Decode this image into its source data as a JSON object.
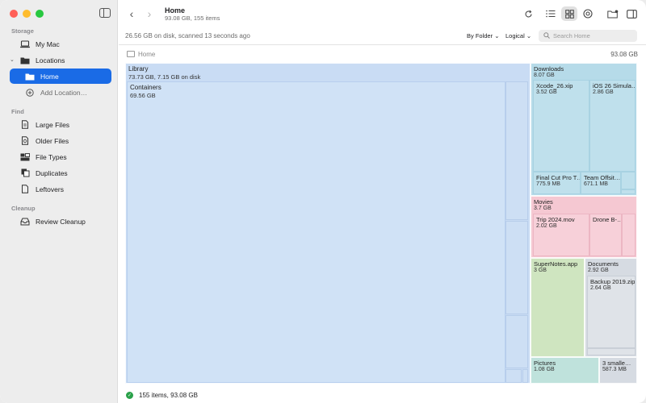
{
  "window": {
    "traffic_colors": [
      "#ff5f57",
      "#febc2e",
      "#28c840"
    ]
  },
  "sidebar": {
    "sections": [
      {
        "title": "Storage"
      },
      {
        "title": "Find"
      },
      {
        "title": "Cleanup"
      }
    ],
    "storage_item": "My Mac",
    "locations_label": "Locations",
    "locations_children": [
      "Home",
      "Add Location…"
    ],
    "find_items": [
      "Large Files",
      "Older Files",
      "File Types",
      "Duplicates",
      "Leftovers"
    ],
    "cleanup_items": [
      "Review Cleanup"
    ],
    "selected_color": "#1a6be6"
  },
  "toolbar": {
    "title": "Home",
    "subtitle": "93.08 GB, 155 items",
    "icons": [
      "chevron-left-icon",
      "chevron-right-icon",
      "refresh-icon",
      "list-view-icon",
      "grid-view-icon",
      "target-icon",
      "folder-badge-icon",
      "sidebar-right-icon"
    ]
  },
  "infobar": {
    "scanned": "26.56 GB on disk, scanned 13 seconds ago",
    "group_by": "By Folder",
    "size_mode": "Logical",
    "search_placeholder": "Search Home"
  },
  "pathbar": {
    "path": "Home",
    "size": "93.08 GB"
  },
  "treemap": {
    "library": {
      "name": "Library",
      "size": "73.73 GB, 7.15 GB on disk"
    },
    "containers": {
      "name": "Containers",
      "size": "69.56 GB"
    },
    "downloads": {
      "name": "Downloads",
      "size": "8.07 GB"
    },
    "xcode": {
      "name": "Xcode_26.xip",
      "size": "3.52 GB"
    },
    "ios_sim": {
      "name": "iOS 26 Simula…",
      "size": "2.86 GB"
    },
    "fcp": {
      "name": "Final Cut Pro T…",
      "size": "775.9 MB"
    },
    "team": {
      "name": "Team Offsit…",
      "size": "671.1 MB"
    },
    "movies": {
      "name": "Movies",
      "size": "3.7 GB"
    },
    "trip": {
      "name": "Trip 2024.mov",
      "size": "2.02 GB"
    },
    "drone": {
      "name": "Drone B-…",
      "size": ""
    },
    "supernotes": {
      "name": "SuperNotes.app",
      "size": "3 GB"
    },
    "documents": {
      "name": "Documents",
      "size": "2.92 GB"
    },
    "backup": {
      "name": "Backup 2019.zip",
      "size": "2.64 GB"
    },
    "pictures": {
      "name": "Pictures",
      "size": "1.08 GB"
    },
    "smaller": {
      "name": "3 smalle…",
      "size": "587.3 MB"
    }
  },
  "statusbar": {
    "text": "155 items, 93.08 GB"
  }
}
